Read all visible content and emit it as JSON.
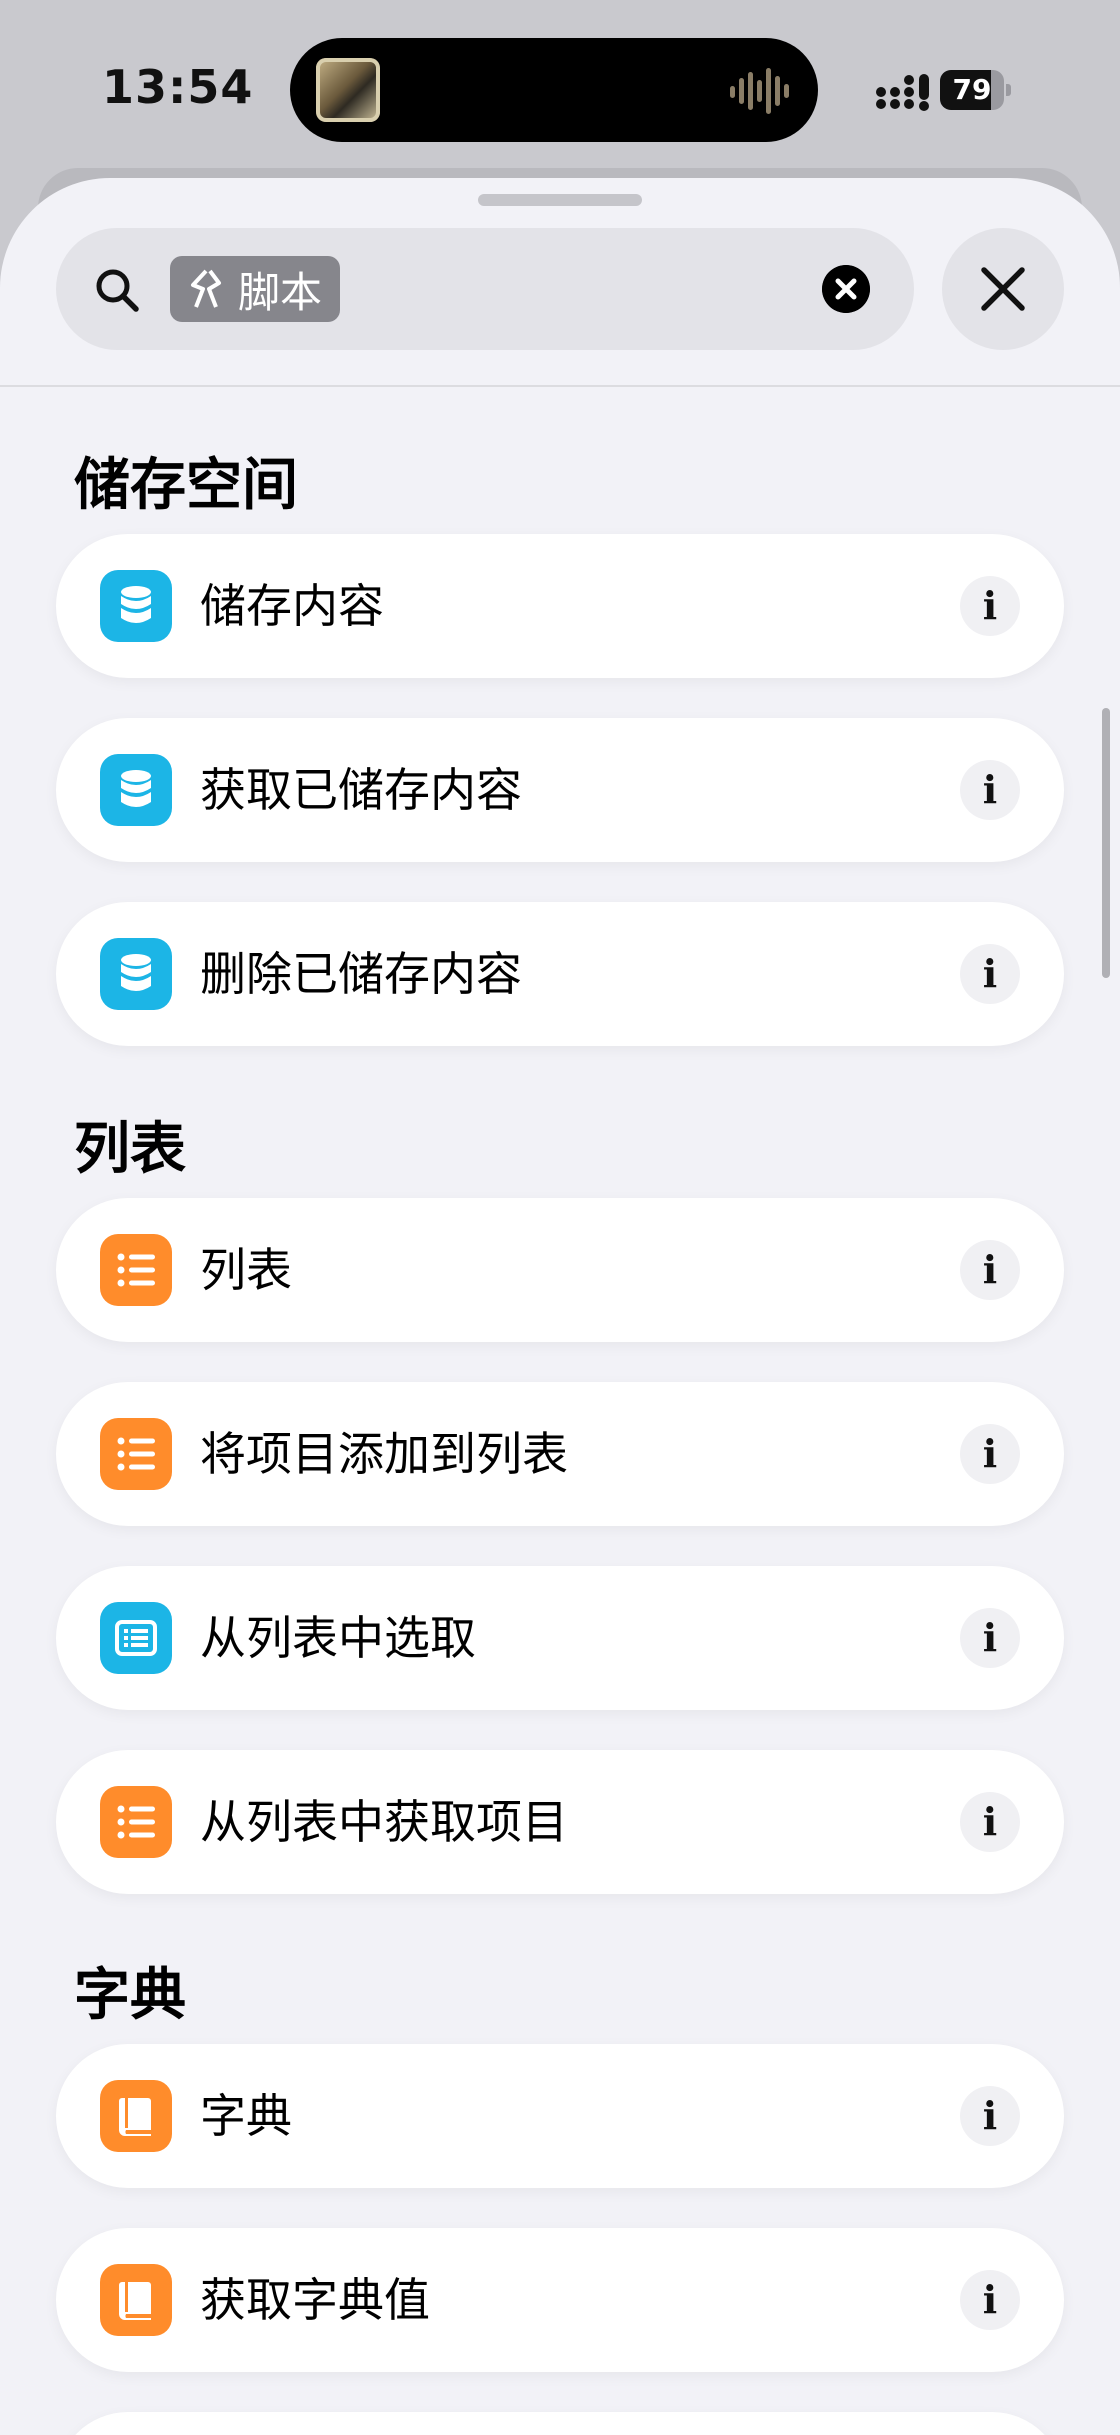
{
  "status_bar": {
    "time": "13:54",
    "battery": "79",
    "battery_level": 0.79
  },
  "search": {
    "token_label": "脚本"
  },
  "sections": [
    {
      "title": "储存空间",
      "items": [
        {
          "label": "储存内容",
          "icon": "database-icon",
          "color": "#1cb5e6"
        },
        {
          "label": "获取已储存内容",
          "icon": "database-icon",
          "color": "#1cb5e6"
        },
        {
          "label": "删除已储存内容",
          "icon": "database-icon",
          "color": "#1cb5e6"
        }
      ]
    },
    {
      "title": "列表",
      "items": [
        {
          "label": "列表",
          "icon": "list-icon",
          "color": "#ff8c2b"
        },
        {
          "label": "将项目添加到列表",
          "icon": "list-icon",
          "color": "#ff8c2b"
        },
        {
          "label": "从列表中选取",
          "icon": "text-list-icon",
          "color": "#1cb5e6"
        },
        {
          "label": "从列表中获取项目",
          "icon": "list-icon",
          "color": "#ff8c2b"
        }
      ]
    },
    {
      "title": "字典",
      "items": [
        {
          "label": "字典",
          "icon": "book-icon",
          "color": "#ff8c2b"
        },
        {
          "label": "获取字典值",
          "icon": "book-icon",
          "color": "#ff8c2b"
        }
      ]
    }
  ],
  "info_glyph": "i"
}
